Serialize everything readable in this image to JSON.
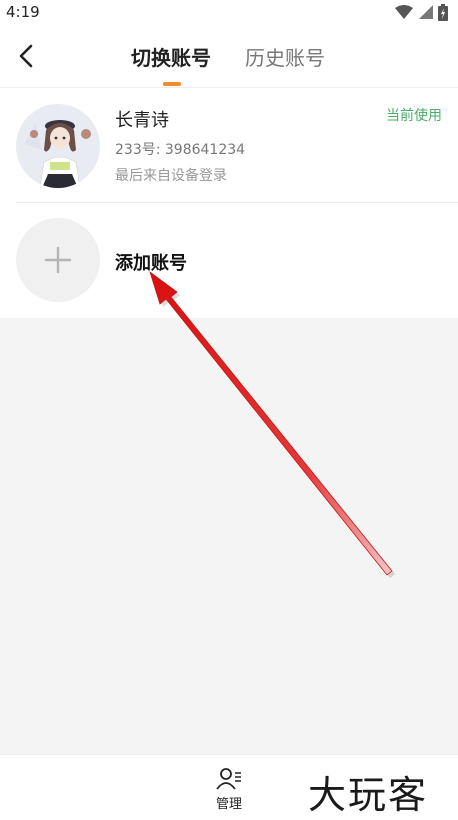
{
  "status_bar": {
    "time": "4:19"
  },
  "header": {
    "tabs": [
      {
        "label": "切换账号",
        "active": true
      },
      {
        "label": "历史账号",
        "active": false
      }
    ],
    "accent_color": "#f08a2c"
  },
  "account": {
    "name": "长青诗",
    "id_line": "233号: 398641234",
    "login_info": "最后来自设备登录",
    "current_badge": "当前使用",
    "badge_color": "#4cab6a"
  },
  "add_account": {
    "label": "添加账号"
  },
  "bottom_bar": {
    "manage_label": "管理"
  },
  "watermark": {
    "text": "大玩客"
  },
  "icons": [
    "back-icon",
    "wifi-icon",
    "signal-icon",
    "battery-icon",
    "plus-icon",
    "manage-icon",
    "annotation-arrow"
  ]
}
